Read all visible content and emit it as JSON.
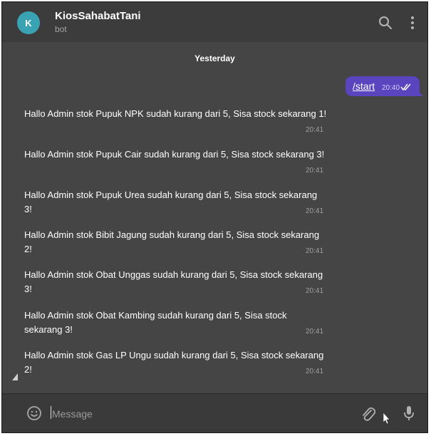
{
  "header": {
    "avatar_letter": "K",
    "title": "KiosSahabatTani",
    "subtitle": "bot",
    "icons": [
      "search-icon",
      "more-vertical-icon"
    ]
  },
  "conversation": {
    "date_separator": "Yesterday",
    "outgoing": [
      {
        "text": "/start",
        "time": "20:40",
        "status_icon": "double-check-icon"
      }
    ],
    "incoming": [
      {
        "text": "Hallo Admin stok Pupuk NPK sudah kurang dari 5, Sisa stock sekarang 1!",
        "time": "20:41"
      },
      {
        "text": "Hallo Admin stok Pupuk Cair sudah kurang dari 5, Sisa stock sekarang 3!",
        "time": "20:41"
      },
      {
        "text": "Hallo Admin stok Pupuk Urea sudah kurang dari 5, Sisa stock sekarang 3!",
        "time": "20:41"
      },
      {
        "text": "Hallo Admin stok Bibit Jagung sudah kurang dari 5, Sisa stock sekarang 2!",
        "time": "20:41"
      },
      {
        "text": "Hallo Admin stok Obat Unggas sudah kurang dari 5, Sisa stock sekarang 3!",
        "time": "20:41"
      },
      {
        "text": "Hallo Admin stok Obat Kambing sudah kurang dari 5, Sisa stock sekarang 3!",
        "time": "20:41"
      },
      {
        "text": "Hallo Admin stok Gas LP Ungu sudah kurang dari 5, Sisa stock sekarang 2!",
        "time": "20:41"
      }
    ]
  },
  "composer": {
    "placeholder": "Message",
    "icons": [
      "emoji-icon",
      "attach-icon",
      "microphone-icon"
    ]
  },
  "colors": {
    "background": "#454545",
    "header": "#3c3c3c",
    "outgoing_bubble": "#5a45bf",
    "avatar": "#3aa3b3"
  }
}
